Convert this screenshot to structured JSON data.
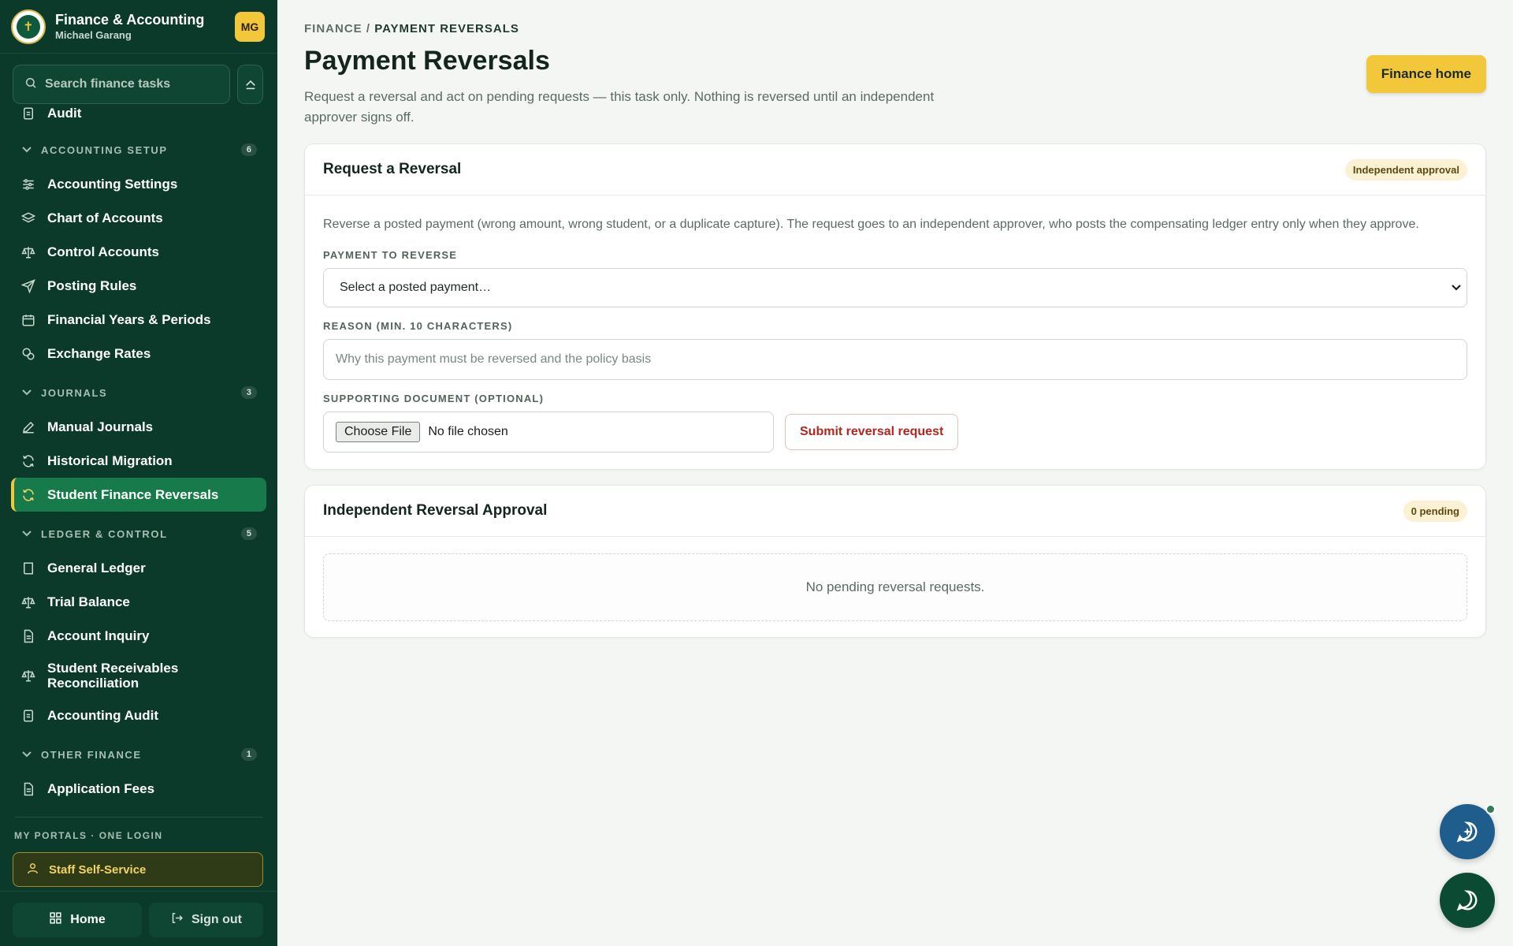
{
  "sidebar": {
    "app_title": "Finance & Accounting",
    "user_name": "Michael Garang",
    "avatar_initials": "MG",
    "search_placeholder": "Search finance tasks",
    "top_item": "Audit",
    "sections": [
      {
        "title": "ACCOUNTING SETUP",
        "count": "6",
        "items": [
          "Accounting Settings",
          "Chart of Accounts",
          "Control Accounts",
          "Posting Rules",
          "Financial Years & Periods",
          "Exchange Rates"
        ]
      },
      {
        "title": "JOURNALS",
        "count": "3",
        "items": [
          "Manual Journals",
          "Historical Migration",
          "Student Finance Reversals"
        ]
      },
      {
        "title": "LEDGER & CONTROL",
        "count": "5",
        "items": [
          "General Ledger",
          "Trial Balance",
          "Account Inquiry",
          "Student Receivables Reconciliation",
          "Accounting Audit"
        ]
      },
      {
        "title": "OTHER FINANCE",
        "count": "1",
        "items": [
          "Application Fees"
        ]
      }
    ],
    "portals_header": "MY PORTALS · ONE LOGIN",
    "staff_self_service": "Staff Self-Service",
    "home_label": "Home",
    "signout_label": "Sign out",
    "accent_color": "#f3c73a",
    "bg_color": "#0b3a2b"
  },
  "main": {
    "breadcrumb_root": "FINANCE",
    "breadcrumb_sep": "/",
    "breadcrumb_current": "PAYMENT REVERSALS",
    "title": "Payment Reversals",
    "description": "Request a reversal and act on pending requests — this task only. Nothing is reversed until an independent approver signs off.",
    "finance_home_label": "Finance home",
    "request_card": {
      "title": "Request a Reversal",
      "badge": "Independent approval",
      "intro": "Reverse a posted payment (wrong amount, wrong student, or a duplicate capture). The request goes to an independent approver, who posts the compensating ledger entry only when they approve.",
      "payment_label": "PAYMENT TO REVERSE",
      "payment_value": "Select a posted payment…",
      "reason_label": "REASON (MIN. 10 CHARACTERS)",
      "reason_placeholder": "Why this payment must be reversed and the policy basis",
      "doc_label": "SUPPORTING DOCUMENT (OPTIONAL)",
      "choose_file": "Choose File",
      "no_file": "No file chosen",
      "submit_label": "Submit reversal request"
    },
    "approval_card": {
      "title": "Independent Reversal Approval",
      "badge": "0 pending",
      "empty_text": "No pending reversal requests."
    }
  }
}
